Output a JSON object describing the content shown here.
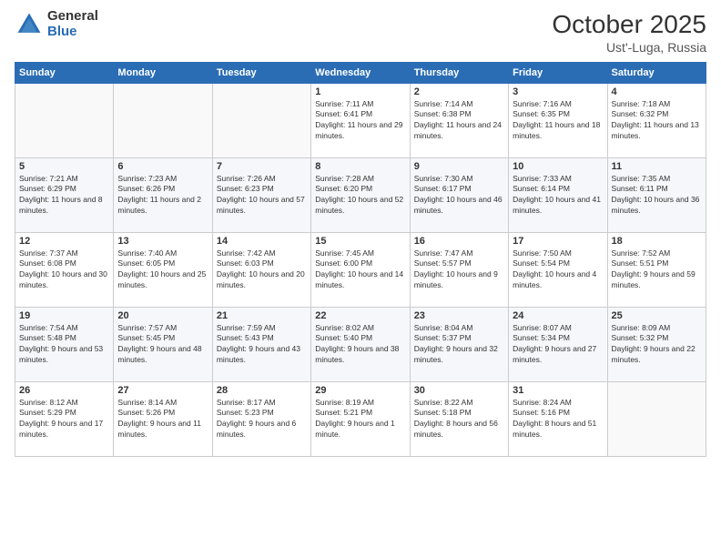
{
  "header": {
    "logo_general": "General",
    "logo_blue": "Blue",
    "month_title": "October 2025",
    "location": "Ust'-Luga, Russia"
  },
  "weekdays": [
    "Sunday",
    "Monday",
    "Tuesday",
    "Wednesday",
    "Thursday",
    "Friday",
    "Saturday"
  ],
  "weeks": [
    [
      {
        "day": "",
        "sunrise": "",
        "sunset": "",
        "daylight": ""
      },
      {
        "day": "",
        "sunrise": "",
        "sunset": "",
        "daylight": ""
      },
      {
        "day": "",
        "sunrise": "",
        "sunset": "",
        "daylight": ""
      },
      {
        "day": "1",
        "sunrise": "7:11 AM",
        "sunset": "6:41 PM",
        "daylight": "11 hours and 29 minutes."
      },
      {
        "day": "2",
        "sunrise": "7:14 AM",
        "sunset": "6:38 PM",
        "daylight": "11 hours and 24 minutes."
      },
      {
        "day": "3",
        "sunrise": "7:16 AM",
        "sunset": "6:35 PM",
        "daylight": "11 hours and 18 minutes."
      },
      {
        "day": "4",
        "sunrise": "7:18 AM",
        "sunset": "6:32 PM",
        "daylight": "11 hours and 13 minutes."
      }
    ],
    [
      {
        "day": "5",
        "sunrise": "7:21 AM",
        "sunset": "6:29 PM",
        "daylight": "11 hours and 8 minutes."
      },
      {
        "day": "6",
        "sunrise": "7:23 AM",
        "sunset": "6:26 PM",
        "daylight": "11 hours and 2 minutes."
      },
      {
        "day": "7",
        "sunrise": "7:26 AM",
        "sunset": "6:23 PM",
        "daylight": "10 hours and 57 minutes."
      },
      {
        "day": "8",
        "sunrise": "7:28 AM",
        "sunset": "6:20 PM",
        "daylight": "10 hours and 52 minutes."
      },
      {
        "day": "9",
        "sunrise": "7:30 AM",
        "sunset": "6:17 PM",
        "daylight": "10 hours and 46 minutes."
      },
      {
        "day": "10",
        "sunrise": "7:33 AM",
        "sunset": "6:14 PM",
        "daylight": "10 hours and 41 minutes."
      },
      {
        "day": "11",
        "sunrise": "7:35 AM",
        "sunset": "6:11 PM",
        "daylight": "10 hours and 36 minutes."
      }
    ],
    [
      {
        "day": "12",
        "sunrise": "7:37 AM",
        "sunset": "6:08 PM",
        "daylight": "10 hours and 30 minutes."
      },
      {
        "day": "13",
        "sunrise": "7:40 AM",
        "sunset": "6:05 PM",
        "daylight": "10 hours and 25 minutes."
      },
      {
        "day": "14",
        "sunrise": "7:42 AM",
        "sunset": "6:03 PM",
        "daylight": "10 hours and 20 minutes."
      },
      {
        "day": "15",
        "sunrise": "7:45 AM",
        "sunset": "6:00 PM",
        "daylight": "10 hours and 14 minutes."
      },
      {
        "day": "16",
        "sunrise": "7:47 AM",
        "sunset": "5:57 PM",
        "daylight": "10 hours and 9 minutes."
      },
      {
        "day": "17",
        "sunrise": "7:50 AM",
        "sunset": "5:54 PM",
        "daylight": "10 hours and 4 minutes."
      },
      {
        "day": "18",
        "sunrise": "7:52 AM",
        "sunset": "5:51 PM",
        "daylight": "9 hours and 59 minutes."
      }
    ],
    [
      {
        "day": "19",
        "sunrise": "7:54 AM",
        "sunset": "5:48 PM",
        "daylight": "9 hours and 53 minutes."
      },
      {
        "day": "20",
        "sunrise": "7:57 AM",
        "sunset": "5:45 PM",
        "daylight": "9 hours and 48 minutes."
      },
      {
        "day": "21",
        "sunrise": "7:59 AM",
        "sunset": "5:43 PM",
        "daylight": "9 hours and 43 minutes."
      },
      {
        "day": "22",
        "sunrise": "8:02 AM",
        "sunset": "5:40 PM",
        "daylight": "9 hours and 38 minutes."
      },
      {
        "day": "23",
        "sunrise": "8:04 AM",
        "sunset": "5:37 PM",
        "daylight": "9 hours and 32 minutes."
      },
      {
        "day": "24",
        "sunrise": "8:07 AM",
        "sunset": "5:34 PM",
        "daylight": "9 hours and 27 minutes."
      },
      {
        "day": "25",
        "sunrise": "8:09 AM",
        "sunset": "5:32 PM",
        "daylight": "9 hours and 22 minutes."
      }
    ],
    [
      {
        "day": "26",
        "sunrise": "8:12 AM",
        "sunset": "5:29 PM",
        "daylight": "9 hours and 17 minutes."
      },
      {
        "day": "27",
        "sunrise": "8:14 AM",
        "sunset": "5:26 PM",
        "daylight": "9 hours and 11 minutes."
      },
      {
        "day": "28",
        "sunrise": "8:17 AM",
        "sunset": "5:23 PM",
        "daylight": "9 hours and 6 minutes."
      },
      {
        "day": "29",
        "sunrise": "8:19 AM",
        "sunset": "5:21 PM",
        "daylight": "9 hours and 1 minute."
      },
      {
        "day": "30",
        "sunrise": "8:22 AM",
        "sunset": "5:18 PM",
        "daylight": "8 hours and 56 minutes."
      },
      {
        "day": "31",
        "sunrise": "8:24 AM",
        "sunset": "5:16 PM",
        "daylight": "8 hours and 51 minutes."
      },
      {
        "day": "",
        "sunrise": "",
        "sunset": "",
        "daylight": ""
      }
    ]
  ],
  "labels": {
    "sunrise_prefix": "Sunrise: ",
    "sunset_prefix": "Sunset: ",
    "daylight_prefix": "Daylight: "
  }
}
